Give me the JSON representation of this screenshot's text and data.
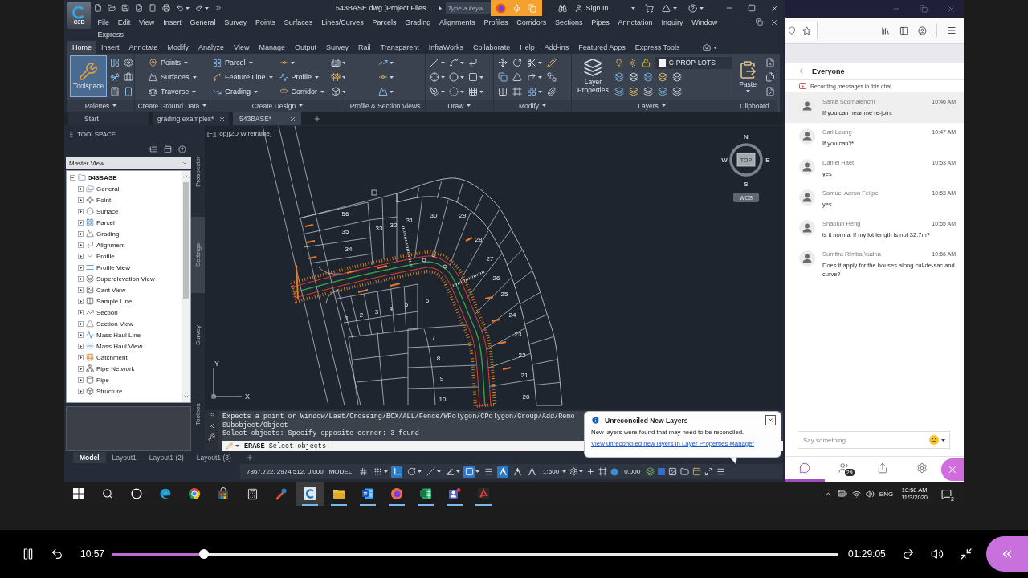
{
  "cad": {
    "title_bar": {
      "app_badge": "C3D",
      "title": "543BASE.dwg [Project Files ...",
      "search_placeholder": "Type a keyw",
      "account": "Sign In"
    },
    "menu_rows": [
      [
        "File",
        "Edit",
        "View",
        "Insert",
        "General",
        "Survey",
        "Points",
        "Surfaces",
        "Lines/Curves",
        "Parcels",
        "Grading",
        "Alignments",
        "Profiles",
        "Corridors",
        "Sections",
        "Pipes",
        "Annotation",
        "Inquiry",
        "Window"
      ],
      [
        "Express"
      ]
    ],
    "ribbon_tabs": [
      {
        "label": "Home",
        "selected": true
      },
      {
        "label": "Insert",
        "selected": false
      },
      {
        "label": "Annotate",
        "selected": false
      },
      {
        "label": "Modify",
        "selected": false
      },
      {
        "label": "Analyze",
        "selected": false
      },
      {
        "label": "View",
        "selected": false
      },
      {
        "label": "Manage",
        "selected": false
      },
      {
        "label": "Output",
        "selected": false
      },
      {
        "label": "Survey",
        "selected": false
      },
      {
        "label": "Rail",
        "selected": false
      },
      {
        "label": "Transparent",
        "selected": false
      },
      {
        "label": "InfraWorks",
        "selected": false
      },
      {
        "label": "Collaborate",
        "selected": false
      },
      {
        "label": "Help",
        "selected": false
      },
      {
        "label": "Add-ins",
        "selected": false
      },
      {
        "label": "Featured Apps",
        "selected": false
      },
      {
        "label": "Express Tools",
        "selected": false
      }
    ],
    "ribbon_panels": [
      {
        "title": "Palettes",
        "dropdown": true,
        "tools": [
          {
            "kind": "large",
            "label": "Toolspace",
            "on": true,
            "dropdown": false
          }
        ]
      },
      {
        "title": "Create Ground Data",
        "dropdown": true,
        "tools": [
          {
            "kind": "menu",
            "label": "Points"
          },
          {
            "kind": "menu",
            "label": "Surfaces"
          },
          {
            "kind": "menu",
            "label": "Traverse"
          }
        ]
      },
      {
        "title": "Create Design",
        "dropdown": true,
        "tools": [
          {
            "kind": "menu",
            "label": "Parcel"
          },
          {
            "kind": "menu",
            "label": "Feature Line"
          },
          {
            "kind": "menu",
            "label": "Grading"
          },
          {
            "kind": "menu",
            "label": "Profile"
          },
          {
            "kind": "menu",
            "label": "Corridor"
          }
        ]
      },
      {
        "title": "Profile & Section Views",
        "dropdown": false
      },
      {
        "title": "Draw",
        "dropdown": true
      },
      {
        "title": "Modify",
        "dropdown": true
      },
      {
        "title": "Layers",
        "dropdown": true,
        "tools": [
          {
            "kind": "large",
            "label": "Layer Properties",
            "on": false,
            "dropdown": false
          },
          {
            "kind": "layer",
            "label": "C-PROP-LOTS"
          }
        ]
      },
      {
        "title": "Clipboard",
        "dropdown": false,
        "tools": [
          {
            "kind": "large",
            "label": "Paste",
            "on": false,
            "dropdown": true
          }
        ]
      }
    ],
    "doc_tabs": [
      {
        "label": "Start",
        "selected": false,
        "closable": false
      },
      {
        "label": "grading examples*",
        "selected": false,
        "closable": true
      },
      {
        "label": "543BASE*",
        "selected": true,
        "closable": true
      }
    ],
    "toolspace": {
      "title": "TOOLSPACE",
      "view": "Master View",
      "tree": [
        {
          "label": "543BASE",
          "expanded": true,
          "children": [
            {
              "label": "General",
              "expanded": false
            },
            {
              "label": "Point",
              "expanded": false
            },
            {
              "label": "Surface",
              "expanded": false
            },
            {
              "label": "Parcel",
              "expanded": false
            },
            {
              "label": "Grading",
              "expanded": false
            },
            {
              "label": "Alignment",
              "expanded": false
            },
            {
              "label": "Profile",
              "expanded": false
            },
            {
              "label": "Profile View",
              "expanded": false
            },
            {
              "label": "Superelevation View",
              "expanded": false
            },
            {
              "label": "Cant View",
              "expanded": false
            },
            {
              "label": "Sample Line",
              "expanded": false
            },
            {
              "label": "Section",
              "expanded": false
            },
            {
              "label": "Section View",
              "expanded": false
            },
            {
              "label": "Mass Haul Line",
              "expanded": false
            },
            {
              "label": "Mass Haul View",
              "expanded": false
            },
            {
              "label": "Catchment",
              "expanded": false
            },
            {
              "label": "Pipe Network",
              "expanded": false
            },
            {
              "label": "Pipe",
              "expanded": false
            },
            {
              "label": "Structure",
              "expanded": false
            }
          ]
        }
      ],
      "side_tabs": [
        {
          "label": "Prospector",
          "selected": false
        },
        {
          "label": "Settings",
          "selected": true
        },
        {
          "label": "Survey",
          "selected": false
        },
        {
          "label": "Toolbox",
          "selected": false
        }
      ]
    },
    "viewport": {
      "label": "[−][Top][2D Wireframe]",
      "compass": {
        "north": "N",
        "east": "E",
        "south": "S",
        "west": "W",
        "face": "TOP",
        "ucs": "WCS"
      },
      "axes": {
        "x": "X",
        "y": "Y"
      },
      "lot_numbers": [
        "56",
        "35",
        "34",
        "33",
        "32",
        "31",
        "30",
        "29",
        "28",
        "27",
        "26",
        "25",
        "24",
        "23",
        "22",
        "21",
        "20",
        "1",
        "2",
        "3",
        "4",
        "5",
        "6",
        "7",
        "8",
        "9",
        "10"
      ]
    },
    "command_line": {
      "history": [
        "Expects a point or Window/Last/Crossing/BOX/ALL/Fence/WPolygon/CPolygon/Group/Add/Remo",
        "SUbobject/Object",
        "Select objects: Specify opposite corner: 3 found"
      ],
      "command": "ERASE",
      "prompt": "Select objects:"
    },
    "notification": {
      "title": "Unreconciled New Layers",
      "message": "New layers were found that may need to be reconciled.",
      "link": "View unreconciled new layers in Layer Properties Manager"
    },
    "layout_tabs": [
      {
        "label": "Model",
        "selected": true
      },
      {
        "label": "Layout1",
        "selected": false
      },
      {
        "label": "Layout1 (2)",
        "selected": false
      },
      {
        "label": "Layout1 (3)",
        "selected": false
      }
    ],
    "status_bar": {
      "coordinates": "7867.722, 2974.512, 0.000",
      "space": "MODEL",
      "toggles": [
        {
          "kind": "grid",
          "on": false,
          "dropdown": false
        },
        {
          "kind": "snap",
          "on": false,
          "dropdown": true
        },
        {
          "kind": "ortho",
          "on": true,
          "dropdown": false
        },
        {
          "kind": "polar",
          "on": false,
          "dropdown": true
        },
        {
          "kind": "isodraft",
          "on": false,
          "dropdown": true
        },
        {
          "kind": "tracking",
          "on": false,
          "dropdown": true
        },
        {
          "kind": "osnap",
          "on": true,
          "dropdown": true
        },
        {
          "kind": "lineweight",
          "on": false,
          "dropdown": false
        },
        {
          "kind": "annotation_visibility",
          "on": true,
          "dropdown": false
        },
        {
          "kind": "autoscale",
          "on": false,
          "dropdown": false
        },
        {
          "kind": "annotation_scale",
          "on": false,
          "dropdown": false
        }
      ],
      "scale": "1:500",
      "transparency": "0.000"
    }
  },
  "chat": {
    "header": "Everyone",
    "recording_notice": "Recording messages in this chat.",
    "messages": [
      {
        "author": "Sante Scornaienchi",
        "time": "10:46 AM",
        "text": "If you can hear me re-join.",
        "selected": true
      },
      {
        "author": "Carl Leung",
        "time": "10:47 AM",
        "text": "If you can't*",
        "selected": false
      },
      {
        "author": "Daniel Haet",
        "time": "10:53 AM",
        "text": "yes",
        "selected": false
      },
      {
        "author": "Samuel Aaron Felipe",
        "time": "10:53 AM",
        "text": "yes",
        "selected": false
      },
      {
        "author": "Shaolun Heng",
        "time": "10:55 AM",
        "text": "is it normal if my lot length is not 32.7m?",
        "selected": false
      },
      {
        "author": "Sumitra Rimba Yudha",
        "time": "10:56 AM",
        "text": "Does it apply for the houses along cul-de-sac and curve?",
        "selected": false
      }
    ],
    "input_placeholder": "Say something",
    "tabs": [
      {
        "kind": "chat",
        "selected": true
      },
      {
        "kind": "participants",
        "selected": false,
        "badge": "29"
      },
      {
        "kind": "share",
        "selected": false
      },
      {
        "kind": "settings",
        "selected": false
      }
    ]
  },
  "taskbar": {
    "apps": [
      {
        "kind": "start",
        "active": false,
        "running": false
      },
      {
        "kind": "search",
        "active": false,
        "running": false
      },
      {
        "kind": "assistant",
        "active": false,
        "running": false
      },
      {
        "kind": "edge",
        "active": false,
        "running": false
      },
      {
        "kind": "chrome",
        "active": false,
        "running": false
      },
      {
        "kind": "store",
        "active": false,
        "running": false
      },
      {
        "kind": "calculator",
        "active": false,
        "running": false
      },
      {
        "kind": "paint_tool",
        "active": false,
        "running": false
      },
      {
        "kind": "civil3d",
        "active": true,
        "running": true
      },
      {
        "kind": "explorer",
        "active": false,
        "running": true
      },
      {
        "kind": "word",
        "active": false,
        "running": true
      },
      {
        "kind": "firefox",
        "active": false,
        "running": true
      },
      {
        "kind": "excel",
        "active": false,
        "running": true
      },
      {
        "kind": "teams",
        "active": false,
        "running": true
      },
      {
        "kind": "acrobat",
        "active": false,
        "running": true
      }
    ],
    "language": "ENG",
    "time": "10:58 AM",
    "date": "11/3/2020",
    "notification_count": "2"
  },
  "player": {
    "playing": true,
    "elapsed": "10:57",
    "level": 0.127,
    "duration": "01:29:05"
  }
}
